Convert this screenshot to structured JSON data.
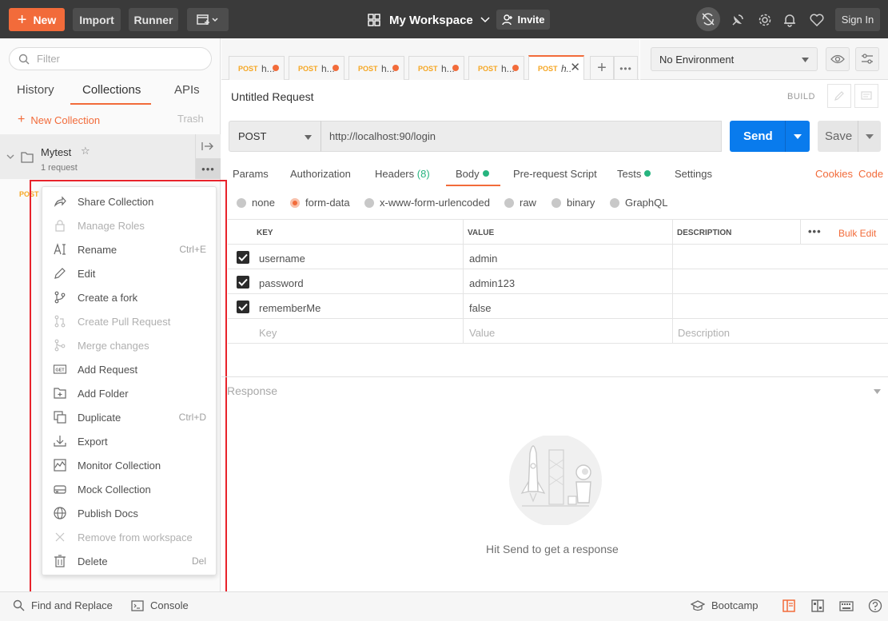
{
  "topbar": {
    "new_label": "New",
    "import_label": "Import",
    "runner_label": "Runner",
    "workspace_label": "My Workspace",
    "invite_label": "Invite",
    "signin_label": "Sign In"
  },
  "sidebar": {
    "filter_placeholder": "Filter",
    "tabs": [
      "History",
      "Collections",
      "APIs"
    ],
    "new_collection": "New Collection",
    "trash": "Trash",
    "collection": {
      "name": "Mytest",
      "count": "1 request"
    },
    "request_method": "POST"
  },
  "context_menu": {
    "items": [
      {
        "label": "Share Collection",
        "shortcut": "",
        "disabled": false,
        "icon": "share-icon"
      },
      {
        "label": "Manage Roles",
        "shortcut": "",
        "disabled": true,
        "icon": "lock-icon"
      },
      {
        "label": "Rename",
        "shortcut": "Ctrl+E",
        "disabled": false,
        "icon": "rename-icon"
      },
      {
        "label": "Edit",
        "shortcut": "",
        "disabled": false,
        "icon": "pencil-icon"
      },
      {
        "label": "Create a fork",
        "shortcut": "",
        "disabled": false,
        "icon": "fork-icon"
      },
      {
        "label": "Create Pull Request",
        "shortcut": "",
        "disabled": true,
        "icon": "pull-request-icon"
      },
      {
        "label": "Merge changes",
        "shortcut": "",
        "disabled": true,
        "icon": "merge-icon"
      },
      {
        "label": "Add Request",
        "shortcut": "",
        "disabled": false,
        "icon": "get-request-icon"
      },
      {
        "label": "Add Folder",
        "shortcut": "",
        "disabled": false,
        "icon": "add-folder-icon"
      },
      {
        "label": "Duplicate",
        "shortcut": "Ctrl+D",
        "disabled": false,
        "icon": "duplicate-icon"
      },
      {
        "label": "Export",
        "shortcut": "",
        "disabled": false,
        "icon": "download-icon"
      },
      {
        "label": "Monitor Collection",
        "shortcut": "",
        "disabled": false,
        "icon": "monitor-icon"
      },
      {
        "label": "Mock Collection",
        "shortcut": "",
        "disabled": false,
        "icon": "server-icon"
      },
      {
        "label": "Publish Docs",
        "shortcut": "",
        "disabled": false,
        "icon": "globe-icon"
      },
      {
        "label": "Remove from workspace",
        "shortcut": "",
        "disabled": true,
        "icon": "close-icon"
      },
      {
        "label": "Delete",
        "shortcut": "Del",
        "disabled": false,
        "icon": "trash-icon"
      }
    ],
    "get_badge": "GET"
  },
  "request_tabs": {
    "method": "POST",
    "short_name": "h...",
    "active_short_name": "h.."
  },
  "environment": {
    "selected": "No Environment"
  },
  "request": {
    "title": "Untitled Request",
    "build_label": "BUILD",
    "method": "POST",
    "url": "http://localhost:90/login",
    "send_label": "Send",
    "save_label": "Save"
  },
  "param_tabs": {
    "params": "Params",
    "authorization": "Authorization",
    "headers": "Headers",
    "headers_count": "(8)",
    "body": "Body",
    "prerequest": "Pre-request Script",
    "tests": "Tests",
    "settings": "Settings",
    "cookies": "Cookies",
    "code": "Code"
  },
  "body_types": [
    "none",
    "form-data",
    "x-www-form-urlencoded",
    "raw",
    "binary",
    "GraphQL"
  ],
  "form_table": {
    "headers": {
      "key": "KEY",
      "value": "VALUE",
      "description": "DESCRIPTION"
    },
    "bulk_edit": "Bulk Edit",
    "rows": [
      {
        "key": "username",
        "value": "admin",
        "description": ""
      },
      {
        "key": "password",
        "value": "admin123",
        "description": ""
      },
      {
        "key": "rememberMe",
        "value": "false",
        "description": ""
      }
    ],
    "placeholder": {
      "key": "Key",
      "value": "Value",
      "description": "Description"
    }
  },
  "response": {
    "title": "Response",
    "empty_message": "Hit Send to get a response"
  },
  "statusbar": {
    "find_replace": "Find and Replace",
    "console": "Console",
    "bootcamp": "Bootcamp"
  },
  "colors": {
    "accent": "#f26b3a",
    "send_blue": "#097bed",
    "topbar": "#3a3a3a",
    "success_green": "#26b47f",
    "highlight_red": "#e8232b"
  }
}
